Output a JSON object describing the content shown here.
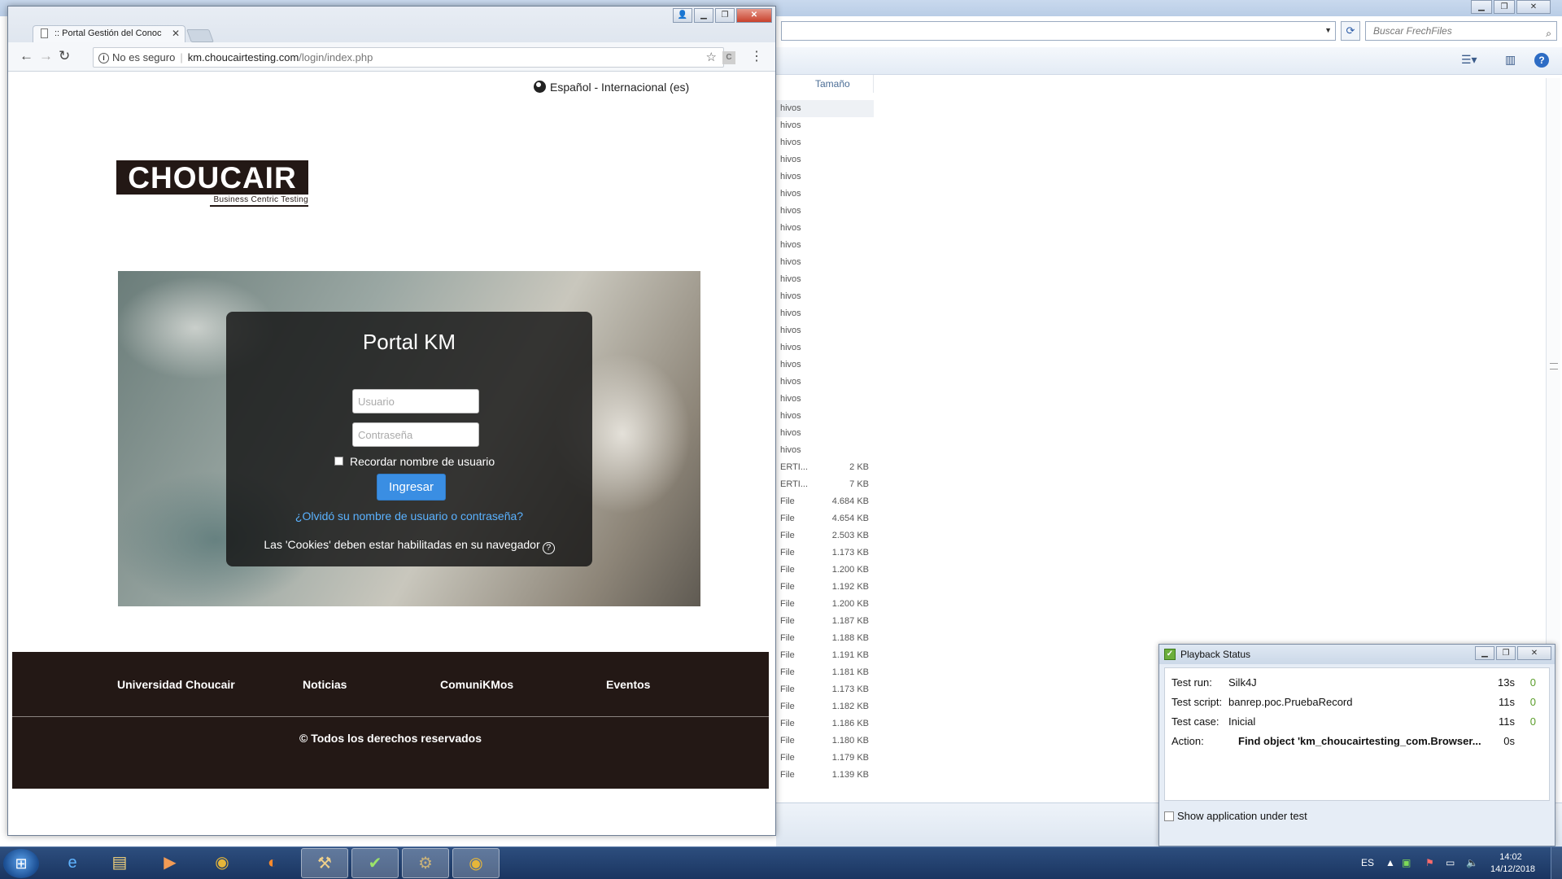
{
  "explorer": {
    "search_placeholder": "Buscar FrechFiles",
    "column_size": "Tamaño",
    "rows": [
      {
        "type": "hivos",
        "size": ""
      },
      {
        "type": "hivos",
        "size": ""
      },
      {
        "type": "hivos",
        "size": ""
      },
      {
        "type": "hivos",
        "size": ""
      },
      {
        "type": "hivos",
        "size": ""
      },
      {
        "type": "hivos",
        "size": ""
      },
      {
        "type": "hivos",
        "size": ""
      },
      {
        "type": "hivos",
        "size": ""
      },
      {
        "type": "hivos",
        "size": ""
      },
      {
        "type": "hivos",
        "size": ""
      },
      {
        "type": "hivos",
        "size": ""
      },
      {
        "type": "hivos",
        "size": ""
      },
      {
        "type": "hivos",
        "size": ""
      },
      {
        "type": "hivos",
        "size": ""
      },
      {
        "type": "hivos",
        "size": ""
      },
      {
        "type": "hivos",
        "size": ""
      },
      {
        "type": "hivos",
        "size": ""
      },
      {
        "type": "hivos",
        "size": ""
      },
      {
        "type": "hivos",
        "size": ""
      },
      {
        "type": "hivos",
        "size": ""
      },
      {
        "type": "hivos",
        "size": ""
      },
      {
        "type": "ERTI...",
        "size": "2 KB"
      },
      {
        "type": "ERTI...",
        "size": "7 KB"
      },
      {
        "type": "File",
        "size": "4.684 KB"
      },
      {
        "type": "File",
        "size": "4.654 KB"
      },
      {
        "type": "File",
        "size": "2.503 KB"
      },
      {
        "type": "File",
        "size": "1.173 KB"
      },
      {
        "type": "File",
        "size": "1.200 KB"
      },
      {
        "type": "File",
        "size": "1.192 KB"
      },
      {
        "type": "File",
        "size": "1.200 KB"
      },
      {
        "type": "File",
        "size": "1.187 KB"
      },
      {
        "type": "File",
        "size": "1.188 KB"
      },
      {
        "type": "File",
        "size": "1.191 KB"
      },
      {
        "type": "File",
        "size": "1.181 KB"
      },
      {
        "type": "File",
        "size": "1.173 KB"
      },
      {
        "type": "File",
        "size": "1.182 KB"
      },
      {
        "type": "File",
        "size": "1.186 KB"
      },
      {
        "type": "File",
        "size": "1.180 KB"
      },
      {
        "type": "File",
        "size": "1.179 KB"
      },
      {
        "type": "File",
        "size": "1.139 KB"
      }
    ]
  },
  "browser": {
    "tab_title": ":: Portal Gestión del Conoc",
    "security_label": "No es seguro",
    "url_host": "km.choucairtesting.com",
    "url_path": "/login/index.php",
    "extension_label": "C"
  },
  "page": {
    "language": "Español - Internacional (es)",
    "logo_text": "CHOUCAIR",
    "logo_subtitle": "Business Centric Testing",
    "login_title": "Portal KM",
    "username_placeholder": "Usuario",
    "password_placeholder": "Contraseña",
    "remember_label": "Recordar nombre de usuario",
    "login_button": "Ingresar",
    "forgot_link": "¿Olvidó su nombre de usuario o contraseña?",
    "cookies_notice": "Las 'Cookies' deben estar habilitadas en su navegador",
    "footer_links": [
      "Universidad Choucair",
      "Noticias",
      "ComuniKMos",
      "Eventos"
    ],
    "copyright": "© Todos los derechos reservados"
  },
  "playback": {
    "title": "Playback Status",
    "rows": [
      {
        "label": "Test run:",
        "value": "Silk4J",
        "time": "13s",
        "count": "0"
      },
      {
        "label": "Test script:",
        "value": "banrep.poc.PruebaRecord",
        "time": "11s",
        "count": "0"
      },
      {
        "label": "Test case:",
        "value": "Inicial",
        "time": "11s",
        "count": "0"
      },
      {
        "label": "Action:",
        "value": "Find object 'km_choucairtesting_com.Browser...",
        "time": "0s",
        "count": ""
      }
    ],
    "show_app_label": "Show application under test"
  },
  "taskbar": {
    "language": "ES",
    "time": "14:02",
    "date": "14/12/2018",
    "apps": [
      "internet-explorer",
      "file-explorer",
      "media-player",
      "chrome",
      "firefox",
      "tools",
      "silk-workbench",
      "java-ee-ide",
      "chrome-active"
    ]
  },
  "colors": {
    "brand_dark": "#231815",
    "login_button": "#3a8ee3",
    "link": "#5ab2ff",
    "taskbar": "#1a3561"
  }
}
